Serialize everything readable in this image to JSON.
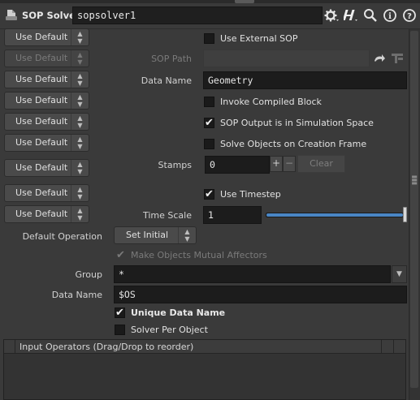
{
  "header": {
    "node_type": "SOP Solver",
    "node_name": "sopsolver1",
    "icons": [
      "gear-icon",
      "houdini-help-icon",
      "search-icon",
      "info-icon",
      "help-icon"
    ],
    "glyph_info": "i",
    "glyph_help": "?"
  },
  "menu_default_label": "Use Default",
  "params": {
    "use_external_sop": "Use External SOP",
    "sop_path_label": "SOP Path",
    "data_name_label": "Data Name",
    "data_name_value": "Geometry",
    "invoke_compiled_block": "Invoke Compiled Block",
    "sop_output_sim_space": "SOP Output is in Simulation Space",
    "solve_on_creation": "Solve Objects on Creation Frame",
    "stamps_label": "Stamps",
    "stamps_value": "0",
    "stamps_plus": "+",
    "stamps_minus": "−",
    "clear_label": "Clear",
    "use_timestep": "Use Timestep",
    "time_scale_label": "Time Scale",
    "time_scale_value": "1",
    "time_scale_slider_fraction": 1.0,
    "default_operation_label": "Default Operation",
    "default_operation_value": "Set Initial",
    "make_mutual_affectors": "Make Objects Mutual Affectors",
    "group_label": "Group",
    "group_value": "*",
    "data_name2_label": "Data Name",
    "data_name2_value": "$OS",
    "unique_data_name": "Unique Data Name",
    "solver_per_object": "Solver Per Object"
  },
  "input_operators": {
    "header": "Input Operators (Drag/Drop to reorder)"
  },
  "colors": {
    "background": "#3a3a3a",
    "field": "#1c1c1c",
    "slider_accent": "#4a86c5"
  }
}
